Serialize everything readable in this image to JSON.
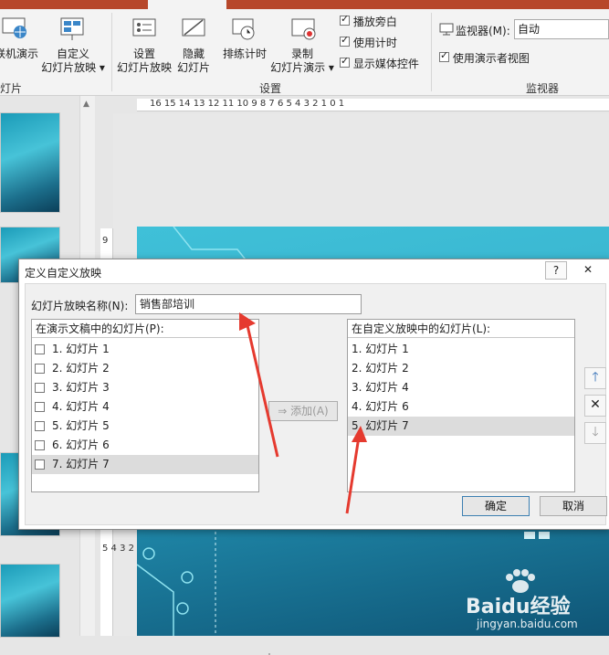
{
  "ribbon": {
    "buttons": [
      {
        "label_line1": "",
        "label_line2": "联机演示"
      },
      {
        "label_line1": "自定义",
        "label_line2": "幻灯片放映"
      },
      {
        "label_line1": "设置",
        "label_line2": "幻灯片放映"
      },
      {
        "label_line1": "隐藏",
        "label_line2": "幻灯片"
      },
      {
        "label_line1": "排练计时",
        "label_line2": ""
      },
      {
        "label_line1": "录制",
        "label_line2": "幻灯片演示"
      }
    ],
    "checkboxes": [
      {
        "label": "播放旁白",
        "checked": true
      },
      {
        "label": "使用计时",
        "checked": true
      },
      {
        "label": "显示媒体控件",
        "checked": true
      }
    ],
    "groups": [
      "灯片",
      "设置",
      "监视器"
    ],
    "monitor": {
      "label": "监视器(M):",
      "value": "自动"
    },
    "presenter_view": {
      "label": "使用演示者视图",
      "checked": true
    }
  },
  "ruler": {
    "horizontal": "16 15 14 13 12 11 10 9 8 7 6 5 4 3 2 1 0 1",
    "vertical_top": "9",
    "vertical_bottom": "5 4 3 2"
  },
  "dialog": {
    "title": "定义自定义放映",
    "help": "?",
    "close": "✕",
    "name_label": "幻灯片放映名称(N):",
    "name_value": "销售部培训",
    "left_header": "在演示文稿中的幻灯片(P):",
    "left_items": [
      "1. 幻灯片 1",
      "2. 幻灯片 2",
      "3. 幻灯片 3",
      "4. 幻灯片 4",
      "5. 幻灯片 5",
      "6. 幻灯片 6",
      "7. 幻灯片 7"
    ],
    "left_selected_index": 6,
    "add_button": "添加(A)",
    "right_header": "在自定义放映中的幻灯片(L):",
    "right_items": [
      "1. 幻灯片 1",
      "2. 幻灯片 2",
      "3. 幻灯片 4",
      "4. 幻灯片 6",
      "5. 幻灯片 7"
    ],
    "right_selected_index": 4,
    "ok": "确定",
    "cancel": "取消"
  },
  "watermark": {
    "brand": "Baidu经验",
    "url": "jingyan.baidu.com"
  },
  "colors": {
    "accent": "#b7472a",
    "arrow": "#e53a2f",
    "slide": "#2aa7c4"
  }
}
